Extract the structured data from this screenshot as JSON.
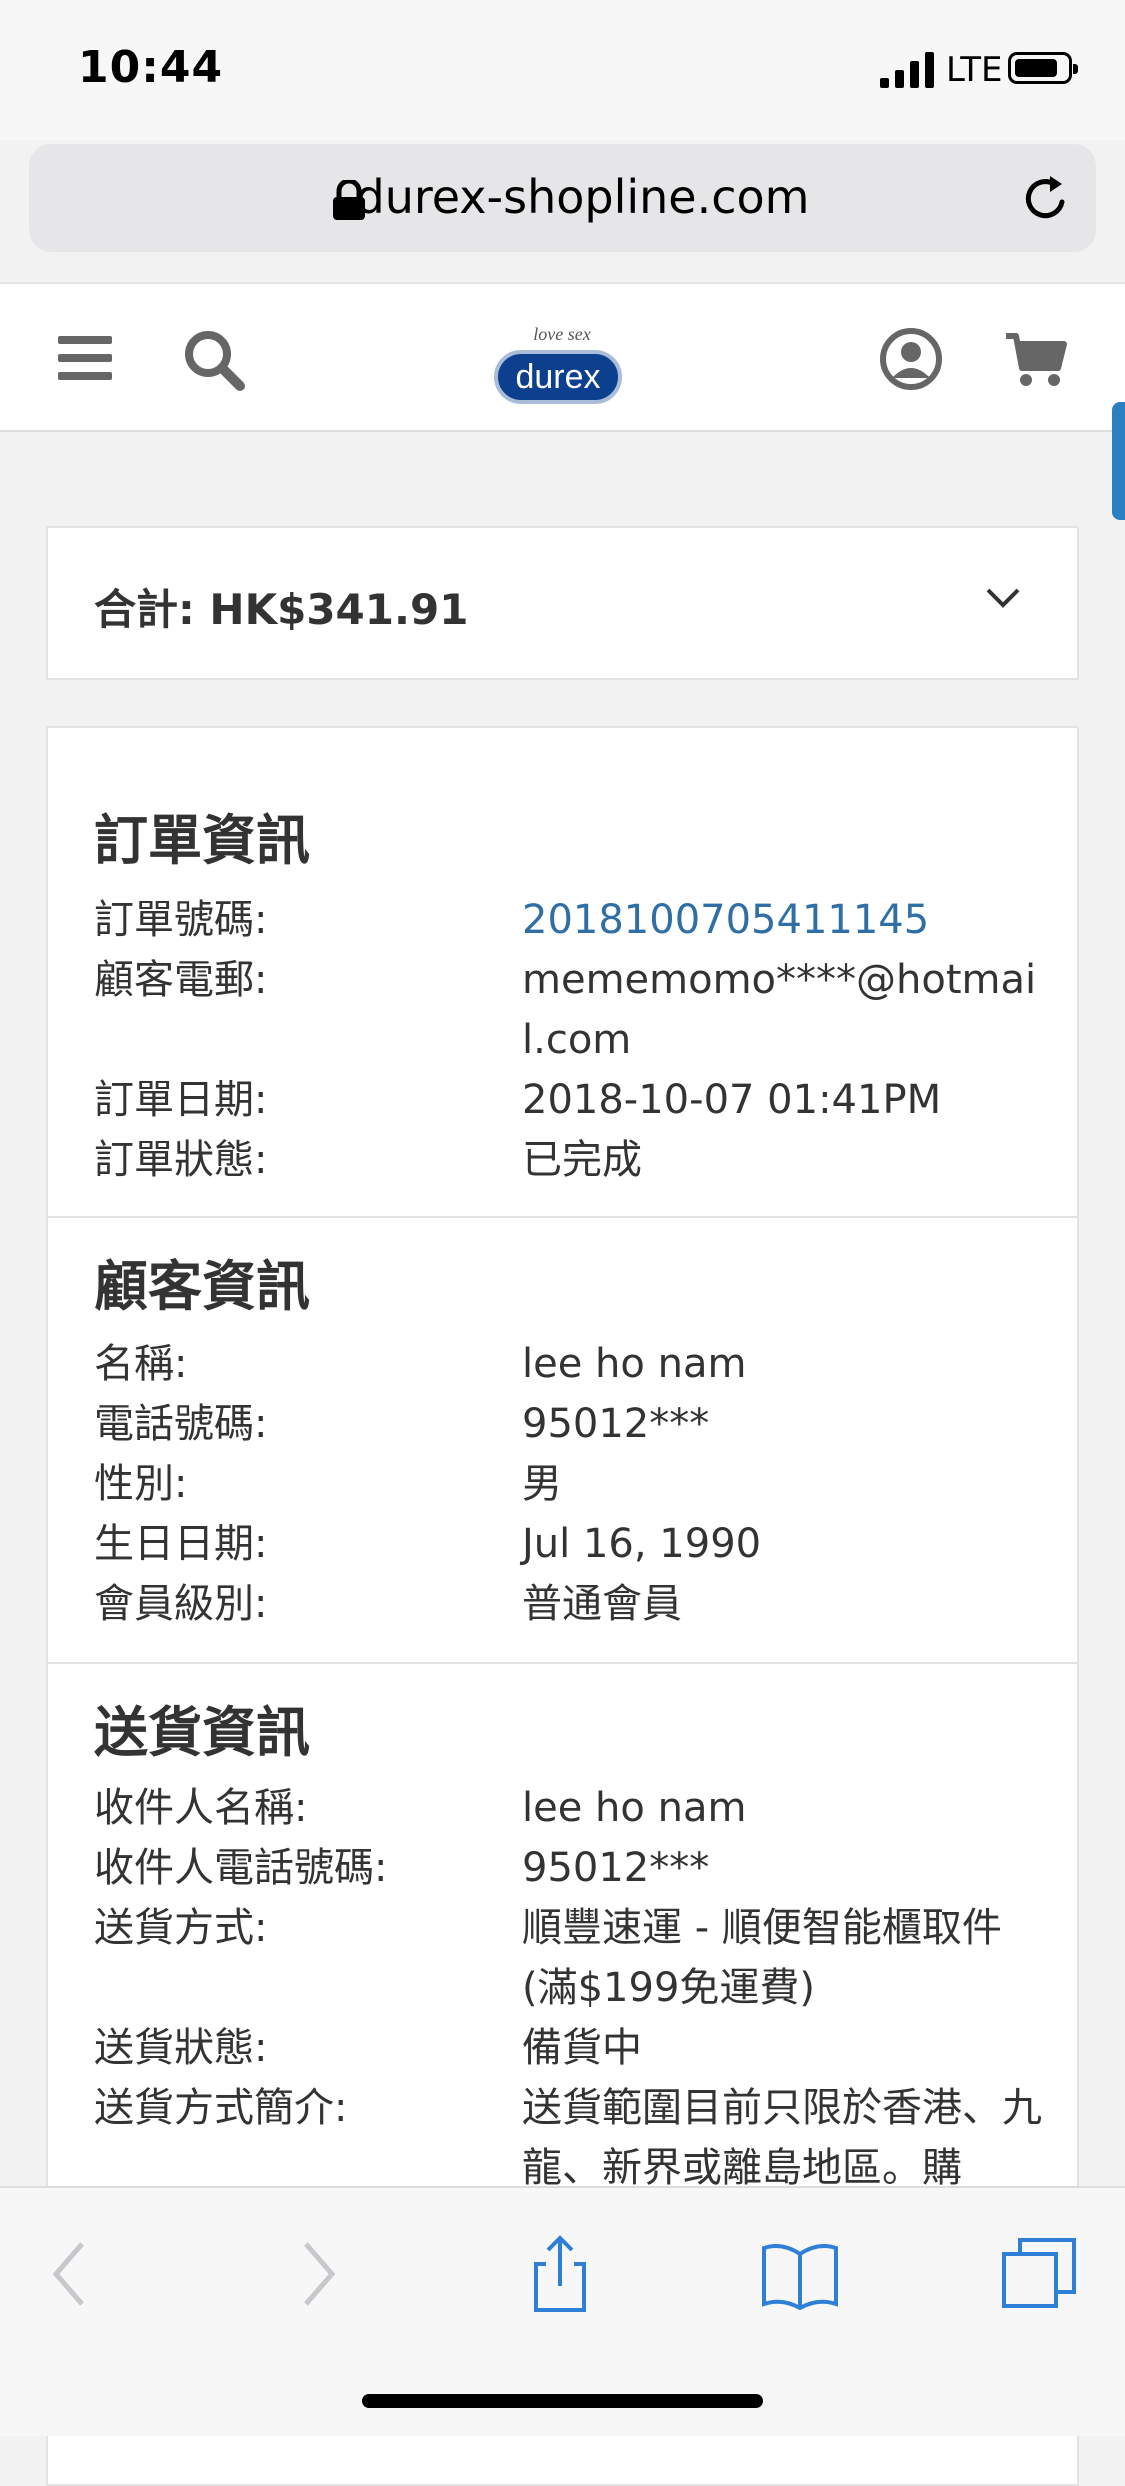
{
  "status_bar": {
    "time": "10:44",
    "network": "LTE"
  },
  "browser": {
    "url": "durex-shopline.com"
  },
  "logo": {
    "tagline": "love sex",
    "brand": "durex"
  },
  "summary": {
    "total_label": "合計: HK$341.91"
  },
  "order_info": {
    "title": "訂單資訊",
    "rows": [
      {
        "label": "訂單號碼:",
        "value": "2018100705411145"
      },
      {
        "label": "顧客電郵:",
        "value": "mememomo****@hotmail.com"
      },
      {
        "label": "訂單日期:",
        "value": "2018-10-07 01:41PM"
      },
      {
        "label": "訂單狀態:",
        "value": "已完成"
      }
    ]
  },
  "customer_info": {
    "title": "顧客資訊",
    "rows": [
      {
        "label": "名稱:",
        "value": "lee ho nam"
      },
      {
        "label": "電話號碼:",
        "value": "95012***"
      },
      {
        "label": "性別:",
        "value": "男"
      },
      {
        "label": "生日日期:",
        "value": "Jul 16, 1990"
      },
      {
        "label": "會員級別:",
        "value": "普通會員"
      }
    ]
  },
  "delivery_info": {
    "title": "送貨資訊",
    "rows": [
      {
        "label": "收件人名稱:",
        "value": "lee ho nam"
      },
      {
        "label": "收件人電話號碼:",
        "value": "95012***"
      },
      {
        "label": "送貨方式:",
        "value": "順豐速運 - 順便智能櫃取件(滿$199免運費)"
      },
      {
        "label": "送貨狀態:",
        "value": "備貨中"
      },
      {
        "label": "送貨方式簡介:",
        "value": "送貨範圍目前只限於香港、九龍、新界或離島地區。購"
      }
    ]
  },
  "colors": {
    "link": "#2f6fa6",
    "accent_tab": "#2b7fc3",
    "toolbar_icon": "#2f7fd6"
  }
}
